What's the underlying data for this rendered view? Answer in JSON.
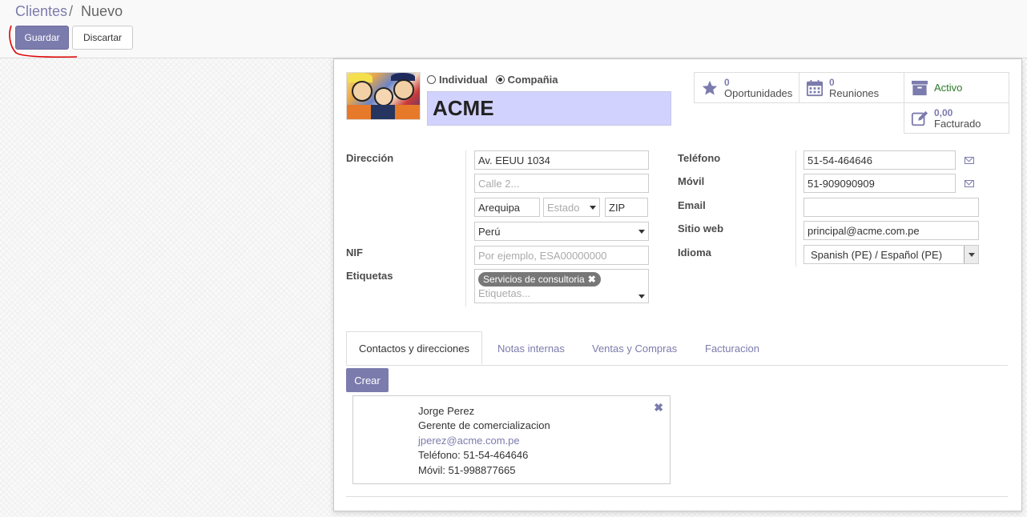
{
  "breadcrumb": {
    "parent": "Clientes",
    "separator": "/",
    "current": "Nuevo"
  },
  "buttons": {
    "save": "Guardar",
    "discard": "Discartar"
  },
  "partner": {
    "type_individual": "Individual",
    "type_company": "Compañia",
    "selected_type": "company",
    "name": "ACME"
  },
  "stats": {
    "opportunities": {
      "value": "0",
      "label": "Oportunidades",
      "icon": "star-icon"
    },
    "meetings": {
      "value": "0",
      "label": "Reuniones",
      "icon": "calendar-icon"
    },
    "active": {
      "label": "Activo",
      "icon": "archive-icon"
    },
    "invoiced": {
      "value": "0,00",
      "label": "Facturado",
      "icon": "edit-icon"
    }
  },
  "labels": {
    "address": "Dirección",
    "vat": "NIF",
    "tags": "Etiquetas",
    "phone": "Teléfono",
    "mobile": "Móvil",
    "email": "Email",
    "website": "Sitio web",
    "language": "Idioma"
  },
  "fields": {
    "street": "Av. EEUU 1034",
    "street2_placeholder": "Calle 2...",
    "city": "Arequipa",
    "state_placeholder": "Estado",
    "zip": "ZIP",
    "country": "Perú",
    "vat_placeholder": "Por ejemplo, ESA00000000",
    "tag_value": "Servicios de consultoria",
    "tags_placeholder": "Etiquetas...",
    "phone": "51-54-464646",
    "mobile": "51-909090909",
    "email": "",
    "website": "principal@acme.com.pe",
    "language": "Spanish (PE) / Español (PE)"
  },
  "tabs": [
    "Contactos y direcciones",
    "Notas internas",
    "Ventas y Compras",
    "Facturacion"
  ],
  "create_button": "Crear",
  "contact": {
    "name": "Jorge Perez",
    "function": "Gerente de comercializacion",
    "email": "jperez@acme.com.pe",
    "phone": "Teléfono: 51-54-464646",
    "mobile": "Móvil: 51-998877665"
  },
  "colors": {
    "accent": "#7c7bad",
    "name_bg": "#d2d2ff",
    "active_green": "#2a7a2a"
  }
}
